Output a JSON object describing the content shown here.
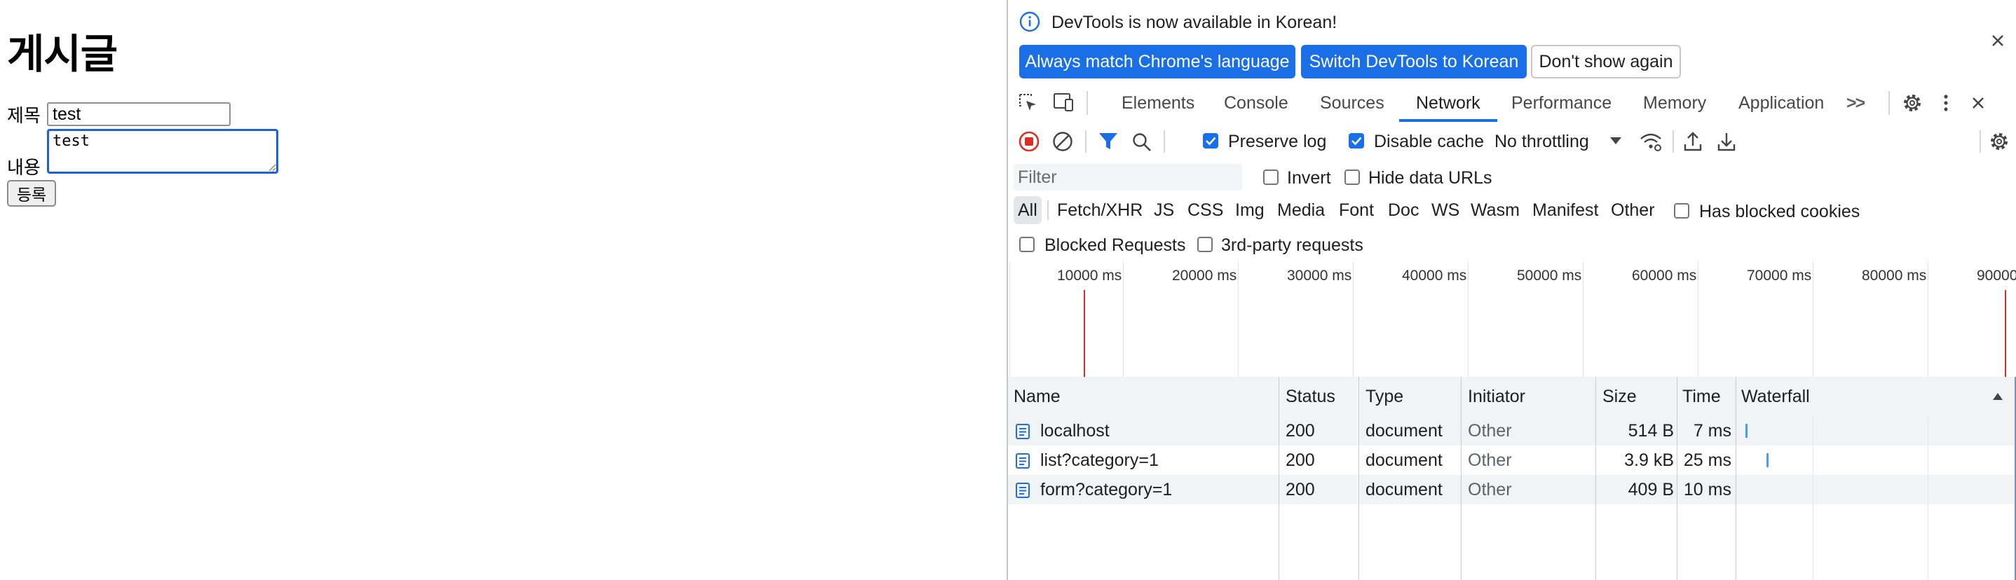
{
  "page": {
    "heading": "게시글",
    "title_label": "제목",
    "title_value": "test",
    "content_label": "내용",
    "content_value": "test",
    "submit_label": "등록"
  },
  "devtools": {
    "infobar": {
      "message": "DevTools is now available in Korean!",
      "btn_match": "Always match Chrome's language",
      "btn_switch": "Switch DevTools to Korean",
      "btn_dismiss": "Don't show again"
    },
    "tabs": [
      "Elements",
      "Console",
      "Sources",
      "Network",
      "Performance",
      "Memory",
      "Application"
    ],
    "active_tab": "Network",
    "more_tabs_symbol": ">>",
    "toolbar": {
      "preserve_log": "Preserve log",
      "preserve_log_checked": true,
      "disable_cache": "Disable cache",
      "disable_cache_checked": true,
      "throttling": "No throttling"
    },
    "filter": {
      "placeholder": "Filter",
      "invert": "Invert",
      "hide_data_urls": "Hide data URLs",
      "types": [
        "All",
        "Fetch/XHR",
        "JS",
        "CSS",
        "Img",
        "Media",
        "Font",
        "Doc",
        "WS",
        "Wasm",
        "Manifest",
        "Other"
      ],
      "has_blocked_cookies": "Has blocked cookies",
      "blocked_requests": "Blocked Requests",
      "third_party": "3rd-party requests"
    },
    "timeline_ticks": [
      "10000 ms",
      "20000 ms",
      "30000 ms",
      "40000 ms",
      "50000 ms",
      "60000 ms",
      "70000 ms",
      "80000 ms",
      "90000 ms"
    ],
    "columns": {
      "name": "Name",
      "status": "Status",
      "type": "Type",
      "initiator": "Initiator",
      "size": "Size",
      "time": "Time",
      "waterfall": "Waterfall"
    },
    "requests": [
      {
        "name": "localhost",
        "status": "200",
        "type": "document",
        "initiator": "Other",
        "size": "514 B",
        "time": "7 ms"
      },
      {
        "name": "list?category=1",
        "status": "200",
        "type": "document",
        "initiator": "Other",
        "size": "3.9 kB",
        "time": "25 ms"
      },
      {
        "name": "form?category=1",
        "status": "200",
        "type": "document",
        "initiator": "Other",
        "size": "409 B",
        "time": "10 ms"
      }
    ],
    "colors": {
      "accent": "#1a6fe6",
      "recording": "#d93025",
      "waterfall_bar": "#4a9ff0"
    }
  }
}
